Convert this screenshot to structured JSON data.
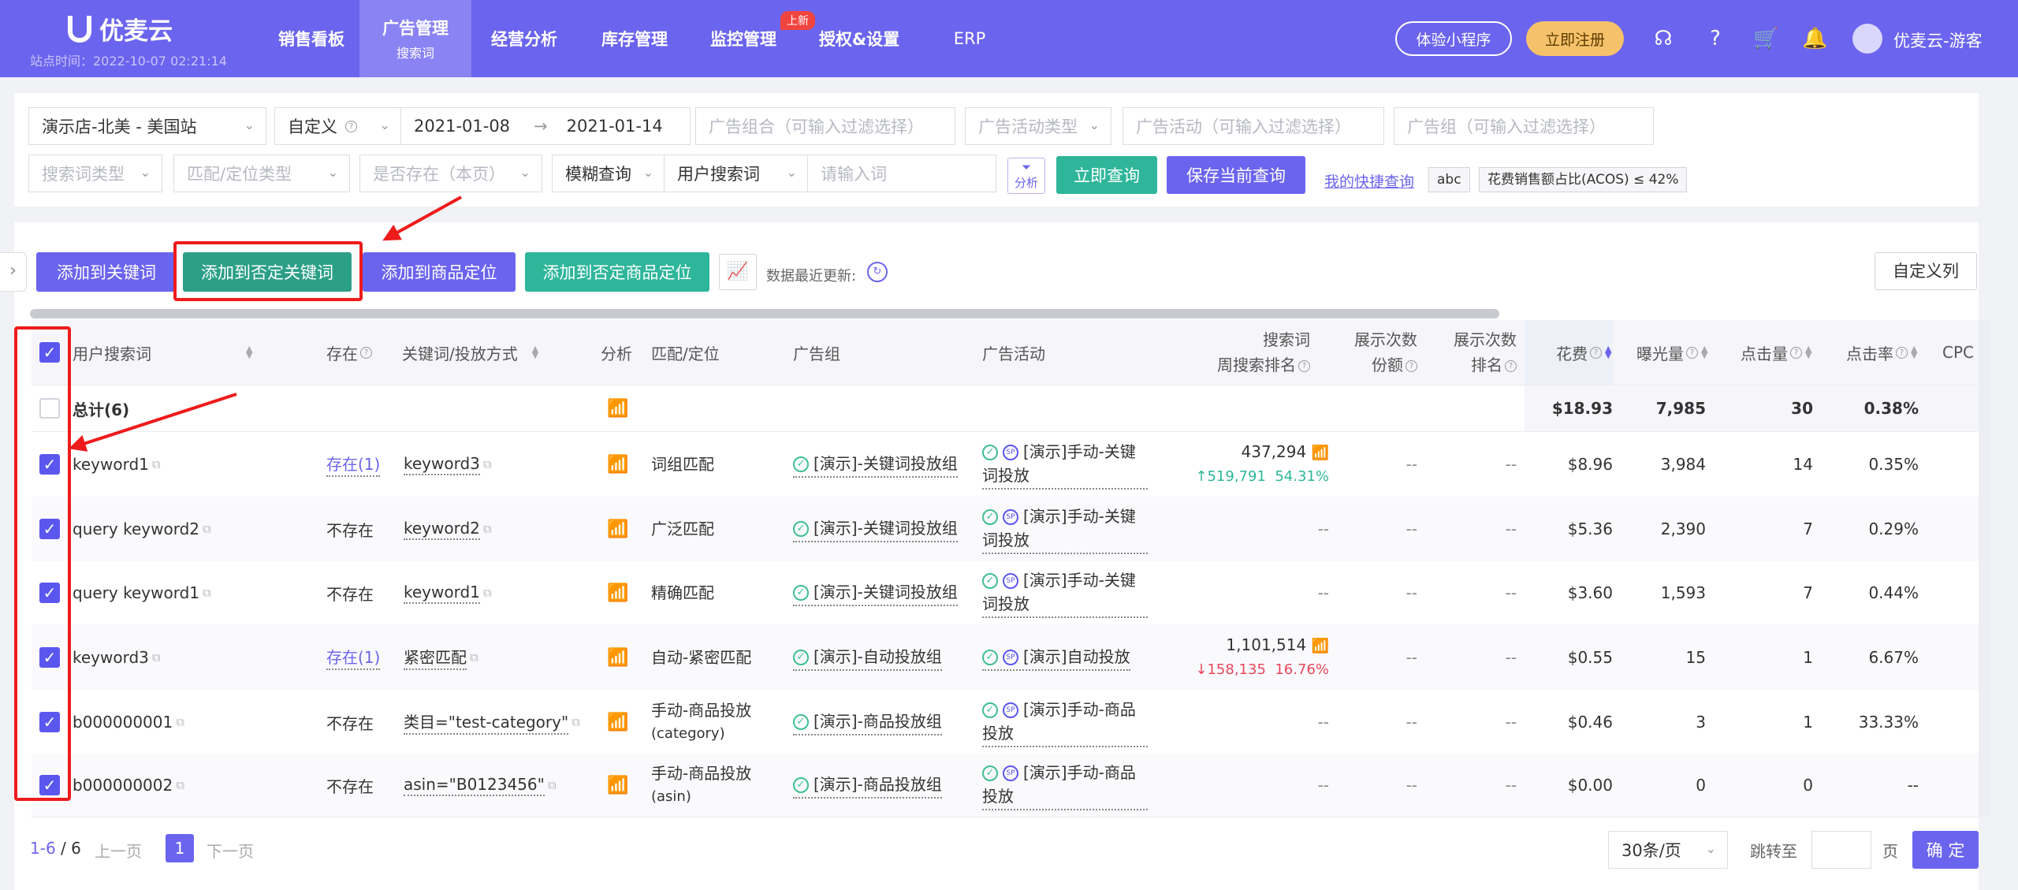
{
  "header": {
    "logo": "优麦云",
    "site_time": "站点时间：2022-10-07 02:21:14",
    "nav": [
      {
        "label": "销售看板"
      },
      {
        "label": "广告管理",
        "sub": "搜索词"
      },
      {
        "label": "经营分析"
      },
      {
        "label": "库存管理"
      },
      {
        "label": "监控管理",
        "badge": "上新"
      },
      {
        "label": "授权&设置"
      },
      {
        "label": "ERP"
      }
    ],
    "mini_program": "体验小程序",
    "register": "立即注册",
    "user": "优麦云-游客"
  },
  "filters": {
    "store": "演示店-北美 - 美国站",
    "date_mode": "自定义",
    "date_start": "2021-01-08",
    "date_arrow": "→",
    "date_end": "2021-01-14",
    "ad_portfolio_ph": "广告组合（可输入过滤选择）",
    "campaign_type_ph": "广告活动类型",
    "campaign_ph": "广告活动（可输入过滤选择）",
    "adgroup_ph": "广告组（可输入过滤选择）",
    "term_type_ph": "搜索词类型",
    "match_type_ph": "匹配/定位类型",
    "exists_ph": "是否存在（本页）",
    "fuzzy": "模糊查询",
    "search_field": "用户搜索词",
    "search_ph": "请输入词",
    "analyze": "分析",
    "query_btn": "立即查询",
    "save_btn": "保存当前查询",
    "my_quick": "我的快捷查询",
    "tag_abc": "abc",
    "tag_acos": "花费销售额占比(ACOS) ≤ 42%"
  },
  "toolbar": {
    "add_keyword": "添加到关键词",
    "add_negative_keyword": "添加到否定关键词",
    "add_product_target": "添加到商品定位",
    "add_negative_product": "添加到否定商品定位",
    "data_updated": "数据最近更新:",
    "custom_columns": "自定义列"
  },
  "table": {
    "headers": {
      "term": "用户搜索词",
      "exists": "存在",
      "keyword": "关键词/投放方式",
      "analyze": "分析",
      "match": "匹配/定位",
      "adgroup": "广告组",
      "campaign": "广告活动",
      "rank_1": "搜索词",
      "rank_2": "周搜索排名",
      "share_1": "展示次数",
      "share_2": "份额",
      "imprank_1": "展示次数",
      "imprank_2": "排名",
      "spend": "花费",
      "impressions": "曝光量",
      "clicks": "点击量",
      "ctr": "点击率",
      "cpc": "CPC"
    },
    "total": {
      "label": "总计(6)",
      "spend": "$18.93",
      "impressions": "7,985",
      "clicks": "30",
      "ctr": "0.38%"
    },
    "rows": [
      {
        "term": "keyword1",
        "exists": "存在(1)",
        "keyword": "keyword3",
        "match": "词组匹配",
        "adgroup": "[演示]-关键词投放组",
        "campaign": "[演示]手动-关键词投放",
        "rank": "437,294",
        "rank_change": "519,791",
        "rank_pct": "54.31%",
        "rank_dir": "up",
        "share": "--",
        "imprank": "--",
        "spend": "$8.96",
        "impressions": "3,984",
        "clicks": "14",
        "ctr": "0.35%"
      },
      {
        "term": "query keyword2",
        "exists": "不存在",
        "keyword": "keyword2",
        "match": "广泛匹配",
        "adgroup": "[演示]-关键词投放组",
        "campaign": "[演示]手动-关键词投放",
        "rank": "--",
        "share": "--",
        "imprank": "--",
        "spend": "$5.36",
        "impressions": "2,390",
        "clicks": "7",
        "ctr": "0.29%"
      },
      {
        "term": "query keyword1",
        "exists": "不存在",
        "keyword": "keyword1",
        "match": "精确匹配",
        "adgroup": "[演示]-关键词投放组",
        "campaign": "[演示]手动-关键词投放",
        "rank": "--",
        "share": "--",
        "imprank": "--",
        "spend": "$3.60",
        "impressions": "1,593",
        "clicks": "7",
        "ctr": "0.44%"
      },
      {
        "term": "keyword3",
        "exists": "存在(1)",
        "keyword": "紧密匹配",
        "match": "自动-紧密匹配",
        "adgroup": "[演示]-自动投放组",
        "campaign": "[演示]自动投放",
        "rank": "1,101,514",
        "rank_change": "158,135",
        "rank_pct": "16.76%",
        "rank_dir": "down",
        "share": "--",
        "imprank": "--",
        "spend": "$0.55",
        "impressions": "15",
        "clicks": "1",
        "ctr": "6.67%"
      },
      {
        "term": "b000000001",
        "exists": "不存在",
        "keyword": "类目=\"test-category\"",
        "match": "手动-商品投放",
        "match_sub": "(category)",
        "adgroup": "[演示]-商品投放组",
        "campaign": "[演示]手动-商品投放",
        "rank": "--",
        "share": "--",
        "imprank": "--",
        "spend": "$0.46",
        "impressions": "3",
        "clicks": "1",
        "ctr": "33.33%"
      },
      {
        "term": "b000000002",
        "exists": "不存在",
        "keyword": "asin=\"B0123456\"",
        "match": "手动-商品投放",
        "match_sub": "(asin)",
        "adgroup": "[演示]-商品投放组",
        "campaign": "[演示]手动-商品投放",
        "rank": "--",
        "share": "--",
        "imprank": "--",
        "spend": "$0.00",
        "impressions": "0",
        "clicks": "0",
        "ctr": "--"
      }
    ]
  },
  "pagination": {
    "range": "1-6",
    "total": "/ 6",
    "prev": "上一页",
    "current": "1",
    "next": "下一页",
    "page_size": "30条/页",
    "jump_to": "跳转至",
    "page_unit": "页",
    "confirm": "确 定"
  },
  "colors": {
    "brand": "#6b64ee",
    "teal": "#2fb69a",
    "highlight": "#ee1b1b"
  }
}
